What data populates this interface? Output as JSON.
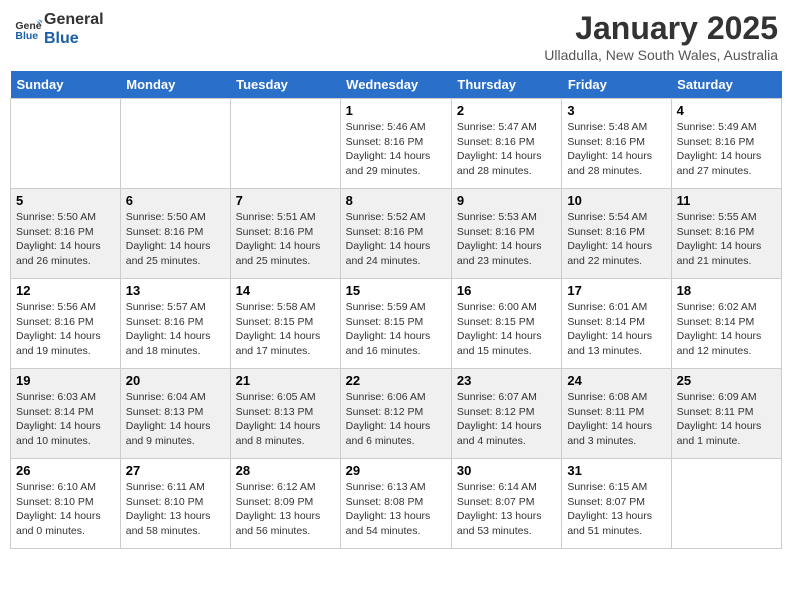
{
  "header": {
    "logo_text_general": "General",
    "logo_text_blue": "Blue",
    "month_title": "January 2025",
    "location": "Ulladulla, New South Wales, Australia"
  },
  "weekdays": [
    "Sunday",
    "Monday",
    "Tuesday",
    "Wednesday",
    "Thursday",
    "Friday",
    "Saturday"
  ],
  "weeks": [
    [
      {
        "day": "",
        "info": ""
      },
      {
        "day": "",
        "info": ""
      },
      {
        "day": "",
        "info": ""
      },
      {
        "day": "1",
        "info": "Sunrise: 5:46 AM\nSunset: 8:16 PM\nDaylight: 14 hours\nand 29 minutes."
      },
      {
        "day": "2",
        "info": "Sunrise: 5:47 AM\nSunset: 8:16 PM\nDaylight: 14 hours\nand 28 minutes."
      },
      {
        "day": "3",
        "info": "Sunrise: 5:48 AM\nSunset: 8:16 PM\nDaylight: 14 hours\nand 28 minutes."
      },
      {
        "day": "4",
        "info": "Sunrise: 5:49 AM\nSunset: 8:16 PM\nDaylight: 14 hours\nand 27 minutes."
      }
    ],
    [
      {
        "day": "5",
        "info": "Sunrise: 5:50 AM\nSunset: 8:16 PM\nDaylight: 14 hours\nand 26 minutes."
      },
      {
        "day": "6",
        "info": "Sunrise: 5:50 AM\nSunset: 8:16 PM\nDaylight: 14 hours\nand 25 minutes."
      },
      {
        "day": "7",
        "info": "Sunrise: 5:51 AM\nSunset: 8:16 PM\nDaylight: 14 hours\nand 25 minutes."
      },
      {
        "day": "8",
        "info": "Sunrise: 5:52 AM\nSunset: 8:16 PM\nDaylight: 14 hours\nand 24 minutes."
      },
      {
        "day": "9",
        "info": "Sunrise: 5:53 AM\nSunset: 8:16 PM\nDaylight: 14 hours\nand 23 minutes."
      },
      {
        "day": "10",
        "info": "Sunrise: 5:54 AM\nSunset: 8:16 PM\nDaylight: 14 hours\nand 22 minutes."
      },
      {
        "day": "11",
        "info": "Sunrise: 5:55 AM\nSunset: 8:16 PM\nDaylight: 14 hours\nand 21 minutes."
      }
    ],
    [
      {
        "day": "12",
        "info": "Sunrise: 5:56 AM\nSunset: 8:16 PM\nDaylight: 14 hours\nand 19 minutes."
      },
      {
        "day": "13",
        "info": "Sunrise: 5:57 AM\nSunset: 8:16 PM\nDaylight: 14 hours\nand 18 minutes."
      },
      {
        "day": "14",
        "info": "Sunrise: 5:58 AM\nSunset: 8:15 PM\nDaylight: 14 hours\nand 17 minutes."
      },
      {
        "day": "15",
        "info": "Sunrise: 5:59 AM\nSunset: 8:15 PM\nDaylight: 14 hours\nand 16 minutes."
      },
      {
        "day": "16",
        "info": "Sunrise: 6:00 AM\nSunset: 8:15 PM\nDaylight: 14 hours\nand 15 minutes."
      },
      {
        "day": "17",
        "info": "Sunrise: 6:01 AM\nSunset: 8:14 PM\nDaylight: 14 hours\nand 13 minutes."
      },
      {
        "day": "18",
        "info": "Sunrise: 6:02 AM\nSunset: 8:14 PM\nDaylight: 14 hours\nand 12 minutes."
      }
    ],
    [
      {
        "day": "19",
        "info": "Sunrise: 6:03 AM\nSunset: 8:14 PM\nDaylight: 14 hours\nand 10 minutes."
      },
      {
        "day": "20",
        "info": "Sunrise: 6:04 AM\nSunset: 8:13 PM\nDaylight: 14 hours\nand 9 minutes."
      },
      {
        "day": "21",
        "info": "Sunrise: 6:05 AM\nSunset: 8:13 PM\nDaylight: 14 hours\nand 8 minutes."
      },
      {
        "day": "22",
        "info": "Sunrise: 6:06 AM\nSunset: 8:12 PM\nDaylight: 14 hours\nand 6 minutes."
      },
      {
        "day": "23",
        "info": "Sunrise: 6:07 AM\nSunset: 8:12 PM\nDaylight: 14 hours\nand 4 minutes."
      },
      {
        "day": "24",
        "info": "Sunrise: 6:08 AM\nSunset: 8:11 PM\nDaylight: 14 hours\nand 3 minutes."
      },
      {
        "day": "25",
        "info": "Sunrise: 6:09 AM\nSunset: 8:11 PM\nDaylight: 14 hours\nand 1 minute."
      }
    ],
    [
      {
        "day": "26",
        "info": "Sunrise: 6:10 AM\nSunset: 8:10 PM\nDaylight: 14 hours\nand 0 minutes."
      },
      {
        "day": "27",
        "info": "Sunrise: 6:11 AM\nSunset: 8:10 PM\nDaylight: 13 hours\nand 58 minutes."
      },
      {
        "day": "28",
        "info": "Sunrise: 6:12 AM\nSunset: 8:09 PM\nDaylight: 13 hours\nand 56 minutes."
      },
      {
        "day": "29",
        "info": "Sunrise: 6:13 AM\nSunset: 8:08 PM\nDaylight: 13 hours\nand 54 minutes."
      },
      {
        "day": "30",
        "info": "Sunrise: 6:14 AM\nSunset: 8:07 PM\nDaylight: 13 hours\nand 53 minutes."
      },
      {
        "day": "31",
        "info": "Sunrise: 6:15 AM\nSunset: 8:07 PM\nDaylight: 13 hours\nand 51 minutes."
      },
      {
        "day": "",
        "info": ""
      }
    ]
  ]
}
